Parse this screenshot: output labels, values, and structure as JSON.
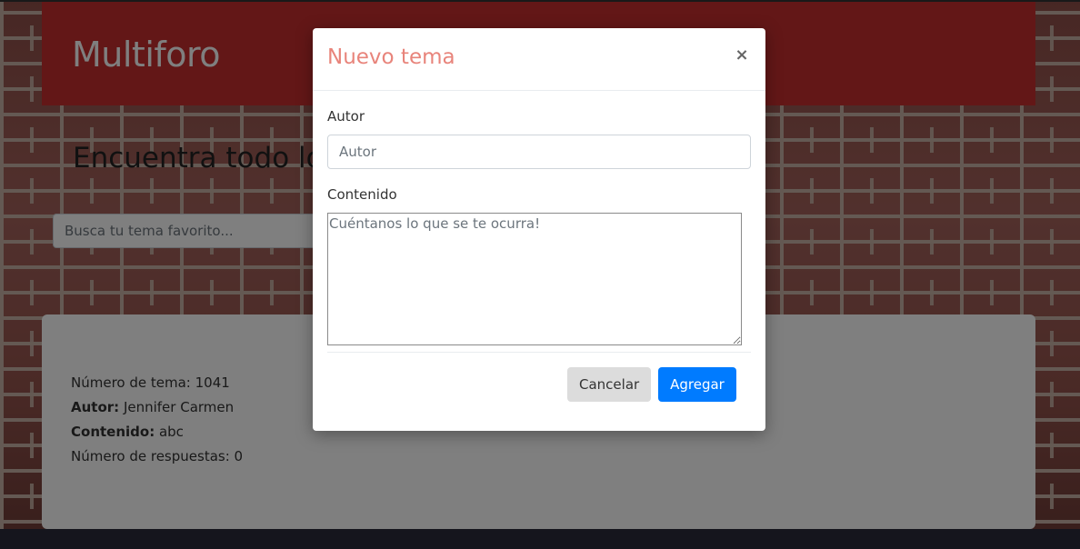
{
  "brand": "Multiforo",
  "hero": {
    "title": "Encuentra todo lo"
  },
  "search": {
    "placeholder": "Busca tu tema favorito..."
  },
  "topic": {
    "number_line": "Número de tema: 1041",
    "author_label": "Autor:",
    "author_value": " Jennifer Carmen",
    "content_label": "Contenido:",
    "content_value": " abc",
    "replies_line": "Número de respuestas: 0"
  },
  "modal": {
    "title": "Nuevo tema",
    "close_glyph": "×",
    "author_label": "Autor",
    "author_placeholder": "Autor",
    "content_label": "Contenido",
    "content_placeholder": "Cuéntanos lo que se te ocurra!",
    "cancel_label": "Cancelar",
    "add_label": "Agregar"
  },
  "colors": {
    "header_bg": "#c62f2f",
    "modal_title": "#e8847b",
    "primary_button": "#007bff",
    "secondary_button": "#dcdcdc"
  }
}
